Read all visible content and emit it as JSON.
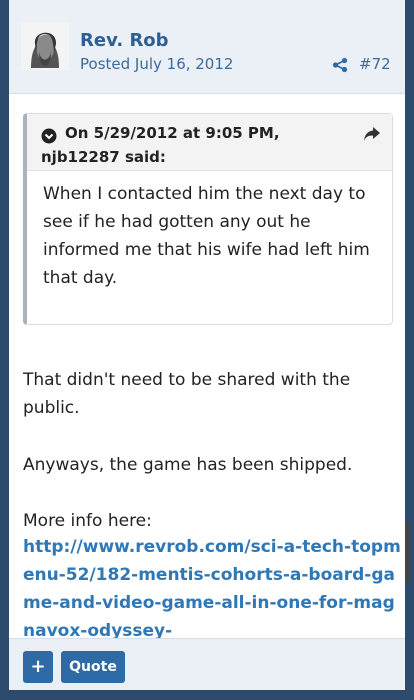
{
  "post": {
    "author": "Rev. Rob",
    "posted": "Posted July 16, 2012",
    "post_number": "#72",
    "avatar_icon": "avatar-portrait-icon",
    "share_icon": "share-icon"
  },
  "quote": {
    "header_line1": "On 5/29/2012 at 9:05 PM,",
    "header_line2": "njb12287 said:",
    "body": "When I contacted him the next day to see if he had gotten any out he informed me that his wife had left him that day."
  },
  "message": {
    "p1": "That didn't need to be shared with the public.",
    "p2": "Anyways, the game has been shipped.",
    "p3": "More info here:",
    "link": "http://www.revrob.com/sci-a-tech-topmenu-52/182-mentis-cohorts-a-board-game-and-video-game-all-in-one-for-magnavox-odyssey-"
  },
  "footer": {
    "plus_label": "+",
    "quote_label": "Quote"
  },
  "colors": {
    "header_bg": "#eaf0f6",
    "accent": "#2e6aa5",
    "link": "#2f78b5"
  }
}
